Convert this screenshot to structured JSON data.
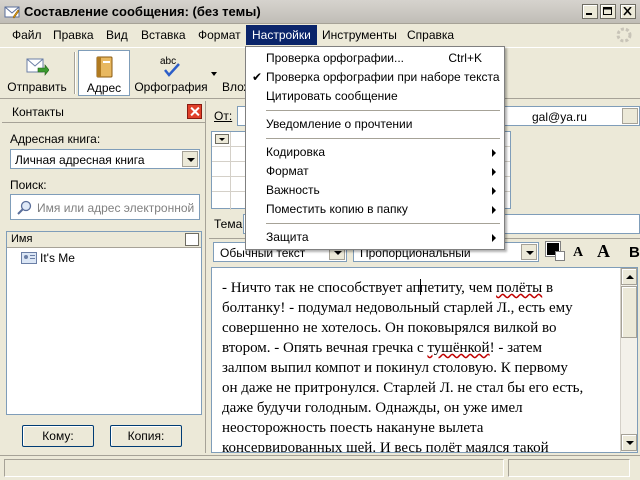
{
  "window": {
    "title": "Составление сообщения: (без темы)"
  },
  "menubar": {
    "items": [
      {
        "label": "Файл",
        "key": "file"
      },
      {
        "label": "Правка",
        "key": "edit"
      },
      {
        "label": "Вид",
        "key": "view"
      },
      {
        "label": "Вставка",
        "key": "insert"
      },
      {
        "label": "Формат",
        "key": "format"
      },
      {
        "label": "Настройки",
        "key": "options",
        "active": true
      },
      {
        "label": "Инструменты",
        "key": "tools"
      },
      {
        "label": "Справка",
        "key": "help"
      }
    ]
  },
  "toolbar": {
    "send": "Отправить",
    "address": "Адрес",
    "spelling": "Орфография",
    "attach": "Влож",
    "spelling_icon_text": "abc"
  },
  "contacts": {
    "title": "Контакты",
    "addressbook_label": "Адресная книга:",
    "addressbook_value": "Личная адресная книга",
    "search_label": "Поиск:",
    "search_placeholder": "Имя или адрес электронной",
    "column_name": "Имя",
    "items": [
      {
        "name": "It's Me"
      }
    ],
    "to_button": "Кому:",
    "cc_button": "Копия:"
  },
  "compose": {
    "from_label": "От:",
    "from_value": "gal@ya.ru",
    "subject_label": "Тема:",
    "format_style": "Обычный текст",
    "format_font": "Пропорциональный",
    "font_grow": "A",
    "font_shrink": "A",
    "bold": "B",
    "body_lines": [
      {
        "parts": [
          {
            "t": "- Ничто так не способствует ап"
          },
          {
            "t": "caret",
            "caret": true
          },
          {
            "t": "петиту, чем "
          },
          {
            "t": "полёты",
            "sp": true
          },
          {
            "t": " в"
          }
        ]
      },
      {
        "parts": [
          {
            "t": "болтанку! - подумал недовольный старлей Л., есть ему"
          }
        ]
      },
      {
        "parts": [
          {
            "t": "совершенно не хотелось. Он поковырялся вилкой во"
          }
        ]
      },
      {
        "parts": [
          {
            "t": "втором. - Опять вечная гречка с "
          },
          {
            "t": "тушёнкой",
            "sp": true
          },
          {
            "t": "! - затем"
          }
        ]
      },
      {
        "parts": [
          {
            "t": "залпом выпил компот и покинул столовую. К первому"
          }
        ]
      },
      {
        "parts": [
          {
            "t": "он даже не притронулся. Старлей Л. не стал бы его есть,"
          }
        ]
      },
      {
        "parts": [
          {
            "t": "даже будучи голодным. Однажды, он уже имел"
          }
        ]
      },
      {
        "parts": [
          {
            "t": "неосторожность поесть накануне вылета"
          }
        ]
      },
      {
        "parts": [
          {
            "t": "консервированных щей. И весь полёт маялся такой"
          }
        ]
      }
    ]
  },
  "options_menu": {
    "items": [
      {
        "label": "Проверка орфографии...",
        "shortcut": "Ctrl+K",
        "checked": false,
        "submenu": false
      },
      {
        "label": "Проверка орфографии при наборе текста",
        "shortcut": "",
        "checked": true,
        "submenu": false
      },
      {
        "label": "Цитировать сообщение",
        "shortcut": "",
        "checked": false,
        "submenu": false,
        "sep_after": true
      },
      {
        "label": "Уведомление о прочтении",
        "shortcut": "",
        "checked": false,
        "submenu": false,
        "sep_after": true
      },
      {
        "label": "Кодировка",
        "shortcut": "",
        "checked": false,
        "submenu": true
      },
      {
        "label": "Формат",
        "shortcut": "",
        "checked": false,
        "submenu": true
      },
      {
        "label": "Важность",
        "shortcut": "",
        "checked": false,
        "submenu": true
      },
      {
        "label": "Поместить копию в папку",
        "shortcut": "",
        "checked": false,
        "submenu": true,
        "sep_after": true
      },
      {
        "label": "Защита",
        "shortcut": "",
        "checked": false,
        "submenu": true
      }
    ],
    "check_glyph": "✔"
  },
  "colors": {
    "menu_highlight": "#0a246a",
    "spell_error": "#c00000",
    "chrome": "#ece9d8"
  }
}
